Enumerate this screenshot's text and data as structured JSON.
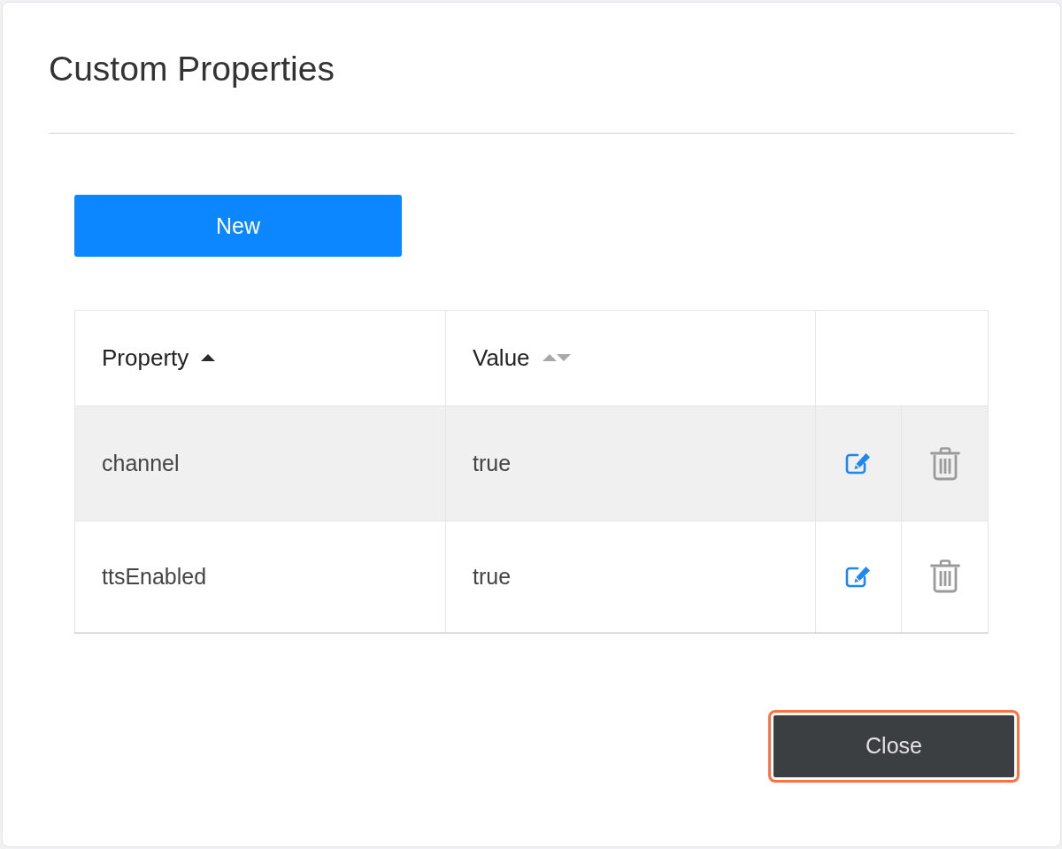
{
  "dialog": {
    "title": "Custom Properties"
  },
  "new_button": {
    "label": "New"
  },
  "table": {
    "columns": [
      {
        "label": "Property",
        "sorted": true
      },
      {
        "label": "Value",
        "sorted": false
      }
    ],
    "rows": [
      {
        "property": "channel",
        "value": "true",
        "highlighted": true
      },
      {
        "property": "ttsEnabled",
        "value": "true",
        "highlighted": false
      }
    ]
  },
  "close_button": {
    "label": "Close",
    "focused": true
  }
}
